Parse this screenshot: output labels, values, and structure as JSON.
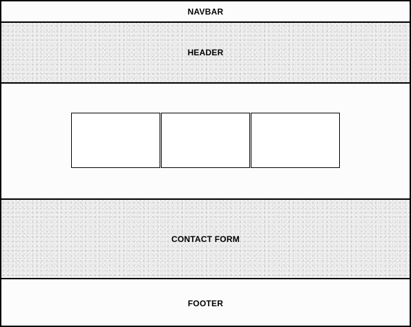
{
  "navbar": {
    "label": "NAVBAR"
  },
  "header": {
    "label": "HEADER"
  },
  "main": {
    "cards": [
      "",
      "",
      ""
    ]
  },
  "contact_form": {
    "label": "CONTACT FORM"
  },
  "footer": {
    "label": "FOOTER"
  }
}
